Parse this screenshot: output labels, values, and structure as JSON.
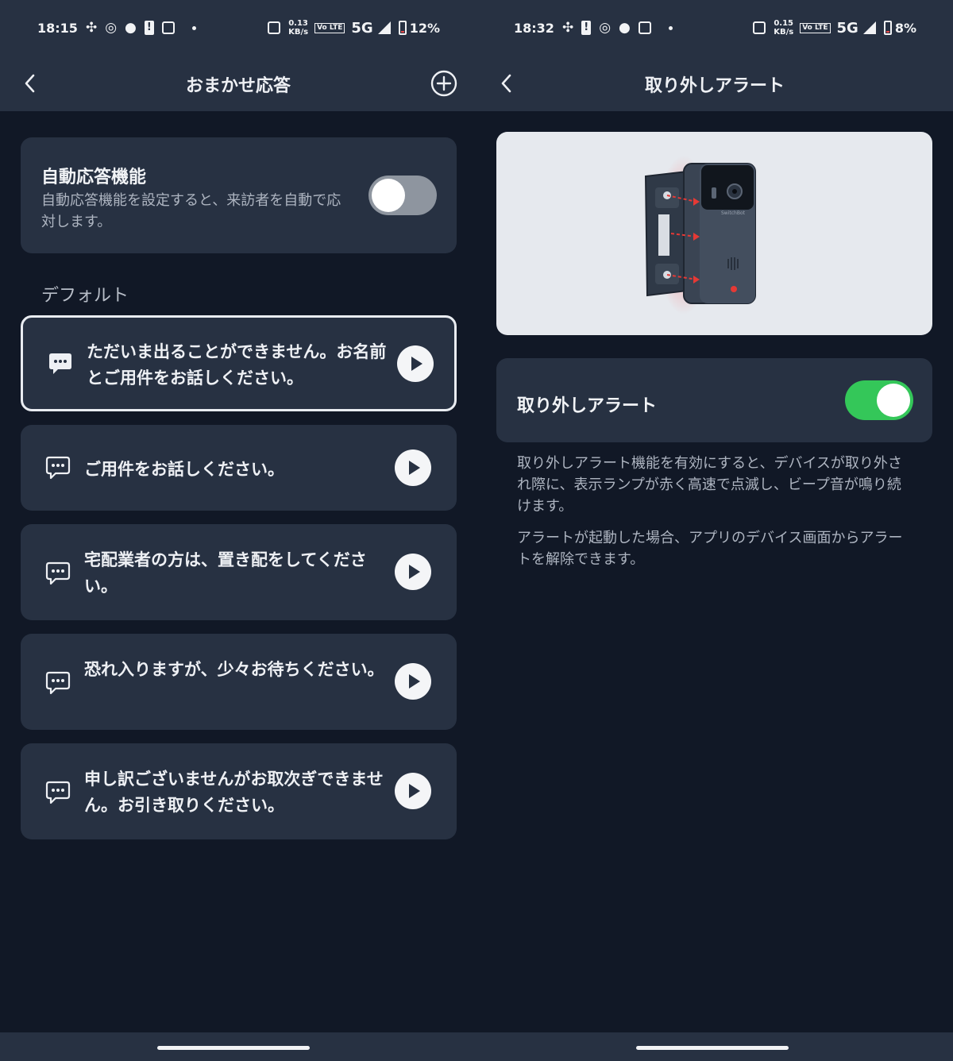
{
  "left": {
    "status": {
      "time": "18:15",
      "net_speed_value": "0.13",
      "net_speed_unit": "KB/s",
      "volte": "Vo LTE",
      "network": "5G",
      "battery": "12%"
    },
    "header": {
      "title": "おまかせ応答",
      "back_icon": "chevron-left-icon",
      "add_icon": "plus-circle-icon"
    },
    "auto_response": {
      "title": "自動応答機能",
      "description": "自動応答機能を設定すると、来訪者を自動で応対します。",
      "enabled": false
    },
    "section_label": "デフォルト",
    "messages": [
      {
        "text": "ただいま出ることができません。お名前とご用件をお話しください。",
        "selected": true,
        "icon": "chat-bubble-icon"
      },
      {
        "text": "ご用件をお話しください。",
        "selected": false,
        "icon": "chat-bubble-outline-icon"
      },
      {
        "text": "宅配業者の方は、置き配をしてください。",
        "selected": false,
        "icon": "chat-bubble-outline-icon"
      },
      {
        "text": "恐れ入りますが、少々お待ちください。",
        "selected": false,
        "icon": "chat-bubble-outline-icon"
      },
      {
        "text": "申し訳ございませんがお取次ぎできません。お引き取りください。",
        "selected": false,
        "icon": "chat-bubble-outline-icon"
      }
    ]
  },
  "right": {
    "status": {
      "time": "18:32",
      "net_speed_value": "0.15",
      "net_speed_unit": "KB/s",
      "volte": "Vo LTE",
      "network": "5G",
      "battery": "8%"
    },
    "header": {
      "title": "取り外しアラート",
      "back_icon": "chevron-left-icon"
    },
    "device_brand": "SwitchBot",
    "alert": {
      "label": "取り外しアラート",
      "enabled": true
    },
    "description_1": "取り外しアラート機能を有効にすると、デバイスが取り外され際に、表示ランプが赤く高速で点滅し、ビープ音が鳴り続けます。",
    "description_2": "アラートが起動した場合、アプリのデバイス画面からアラートを解除できます。"
  },
  "colors": {
    "background": "#111826",
    "card": "#273142",
    "toggle_on": "#34c759",
    "toggle_off": "#8e959f",
    "alert_red": "#e53935"
  }
}
